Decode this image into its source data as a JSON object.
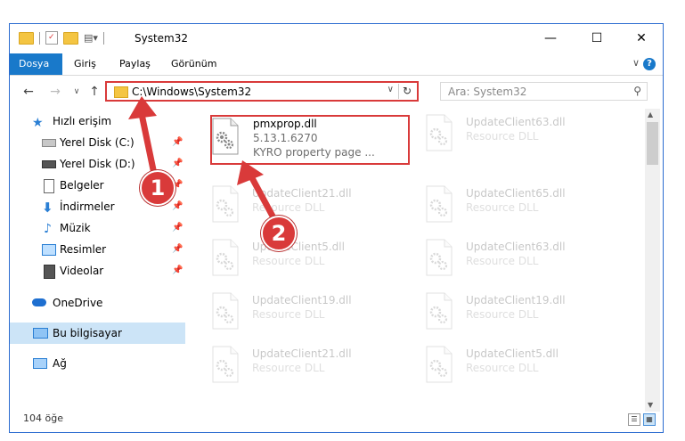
{
  "window": {
    "title": "System32"
  },
  "ribbon": {
    "tabs": [
      "Dosya",
      "Giriş",
      "Paylaş",
      "Görünüm"
    ]
  },
  "address": {
    "path": "C:\\Windows\\System32"
  },
  "search": {
    "placeholder": "Ara: System32"
  },
  "nav": {
    "quick_access": "Hızlı erişim",
    "items": [
      "Yerel Disk (C:)",
      "Yerel Disk (D:)",
      "Belgeler",
      "İndirmeler",
      "Müzik",
      "Resimler",
      "Videolar"
    ],
    "onedrive": "OneDrive",
    "this_pc": "Bu bilgisayar",
    "network": "Ağ"
  },
  "files": {
    "main": {
      "name": "pmxprop.dll",
      "version": "5.13.1.6270",
      "description": "KYRO property page ..."
    },
    "faded": [
      {
        "name": "UpdateClient63.dll",
        "sub": "Resource DLL"
      },
      {
        "name": "UpdateClient21.dll",
        "sub": "Resource DLL"
      },
      {
        "name": "UpdateClient65.dll",
        "sub": "Resource DLL"
      },
      {
        "name": "UpdateClient5.dll",
        "sub": "Resource DLL"
      },
      {
        "name": "UpdateClient63.dll",
        "sub": "Resource DLL"
      },
      {
        "name": "UpdateClient19.dll",
        "sub": "Resource DLL"
      },
      {
        "name": "UpdateClient19.dll",
        "sub": "Resource DLL"
      },
      {
        "name": "UpdateClient21.dll",
        "sub": "Resource DLL"
      },
      {
        "name": "UpdateClient5.dll",
        "sub": "Resource DLL"
      }
    ]
  },
  "status": {
    "count": "104 öğe"
  },
  "badges": {
    "one": "1",
    "two": "2"
  },
  "colors": {
    "accent": "#1979ca",
    "annotation": "#d93a3a",
    "selected": "#cce4f7"
  }
}
